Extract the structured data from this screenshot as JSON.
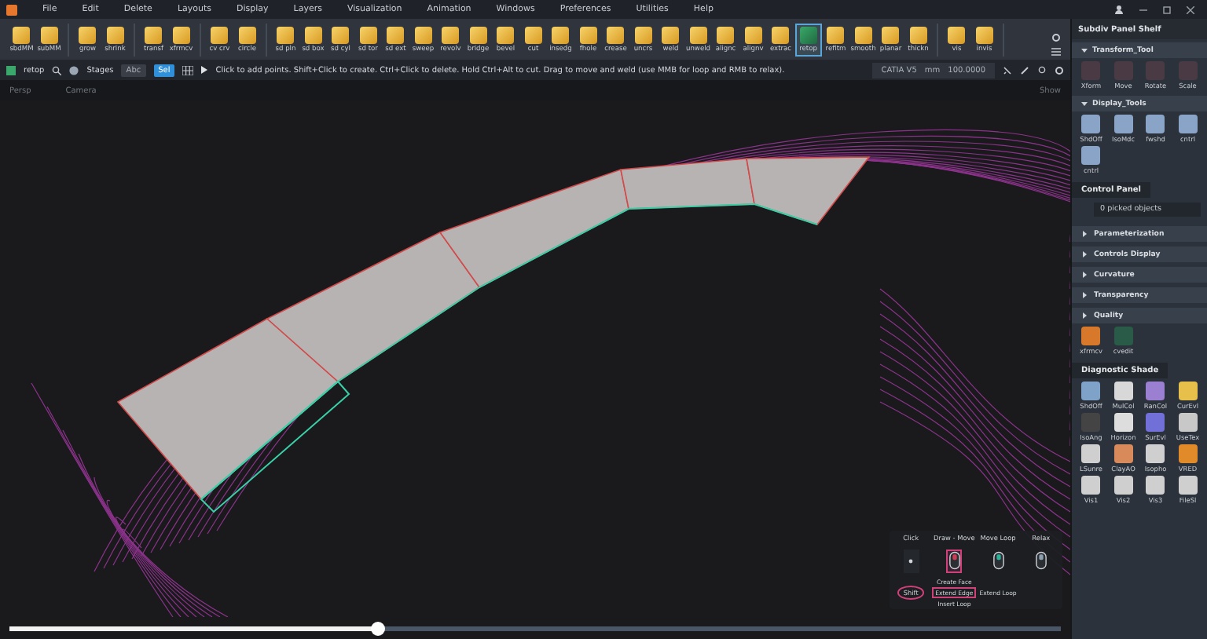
{
  "menu": [
    "File",
    "Edit",
    "Delete",
    "Layouts",
    "Display",
    "Layers",
    "Visualization",
    "Animation",
    "Windows",
    "Preferences",
    "Utilities",
    "Help"
  ],
  "toolbar": {
    "groups": [
      [
        {
          "label": "sbdMM",
          "selected": false
        },
        {
          "label": "subMM",
          "selected": false
        }
      ],
      [
        {
          "label": "grow",
          "selected": false
        },
        {
          "label": "shrink",
          "selected": false
        }
      ],
      [
        {
          "label": "transf",
          "selected": false
        },
        {
          "label": "xfrmcv",
          "selected": false
        }
      ],
      [
        {
          "label": "cv crv",
          "selected": false
        },
        {
          "label": "circle",
          "selected": false
        }
      ],
      [
        {
          "label": "sd pln",
          "selected": false
        },
        {
          "label": "sd box",
          "selected": false
        },
        {
          "label": "sd cyl",
          "selected": false
        },
        {
          "label": "sd tor",
          "selected": false
        },
        {
          "label": "sd ext",
          "selected": false
        },
        {
          "label": "sweep",
          "selected": false
        },
        {
          "label": "revolv",
          "selected": false
        },
        {
          "label": "bridge",
          "selected": false
        },
        {
          "label": "bevel",
          "selected": false
        },
        {
          "label": "cut",
          "selected": false
        },
        {
          "label": "insedg",
          "selected": false
        },
        {
          "label": "fhole",
          "selected": false
        },
        {
          "label": "crease",
          "selected": false
        },
        {
          "label": "uncrs",
          "selected": false
        },
        {
          "label": "weld",
          "selected": false
        },
        {
          "label": "unweld",
          "selected": false
        },
        {
          "label": "alignc",
          "selected": false
        },
        {
          "label": "alignv",
          "selected": false
        },
        {
          "label": "extrac",
          "selected": false
        },
        {
          "label": "retop",
          "selected": true
        },
        {
          "label": "refitm",
          "selected": false
        },
        {
          "label": "smooth",
          "selected": false
        },
        {
          "label": "planar",
          "selected": false
        },
        {
          "label": "thickn",
          "selected": false
        }
      ],
      [
        {
          "label": "vis",
          "selected": false
        },
        {
          "label": "invis",
          "selected": false
        }
      ]
    ]
  },
  "command_bar": {
    "tool": "retop",
    "stages": "Stages",
    "toggles": [
      {
        "label": "Abc",
        "selected": false
      },
      {
        "label": "Sel",
        "selected": true
      }
    ],
    "hint": "Click to add points. Shift+Click to create. Ctrl+Click to delete. Hold Ctrl+Alt to cut. Drag to move and weld (use MMB for loop and RMB to relax).",
    "standard": "CATIA V5",
    "unit": "mm",
    "tolerance": "100.0000"
  },
  "viewport": {
    "view": "Persp",
    "camera": "Camera",
    "show": "Show"
  },
  "mouse_hints": {
    "columns": [
      {
        "title": "Click",
        "highlighted": false
      },
      {
        "title": "Draw - Move",
        "highlighted": true
      },
      {
        "title": "Move Loop",
        "highlighted": false
      },
      {
        "title": "Relax",
        "highlighted": false
      }
    ],
    "modifier": {
      "label": "Shift",
      "highlighted": true
    },
    "actions": [
      {
        "label": "Create Face",
        "highlighted": false
      },
      {
        "label": "Extend Edge",
        "highlighted": true
      },
      {
        "label": "Insert Loop",
        "highlighted": false
      },
      {
        "label": "Extend Loop",
        "highlighted": false
      }
    ]
  },
  "timeline": {
    "level": 0.35
  },
  "right_panel": {
    "title": "Subdiv Panel Shelf",
    "shelves": [
      {
        "title": "Transform_Tool",
        "items": [
          "Xform",
          "Move",
          "Rotate",
          "Scale"
        ]
      },
      {
        "title": "Display_Tools",
        "items": [
          "ShdOff",
          "IsoMdc",
          "fwshd",
          "cntrl",
          "cntrl"
        ]
      }
    ],
    "control_panel": {
      "tab": "Control Panel",
      "picked": "0 picked objects",
      "sections": [
        {
          "label": "Parameterization",
          "expanded": false
        },
        {
          "label": "Controls Display",
          "expanded": false
        },
        {
          "label": "Curvature",
          "expanded": false
        },
        {
          "label": "Transparency",
          "expanded": false
        },
        {
          "label": "Quality",
          "expanded": false
        }
      ]
    },
    "shelf_items": [
      "xfrmcv",
      "cvedit"
    ],
    "diagnostic": {
      "tab": "Diagnostic Shade",
      "items": [
        "ShdOff",
        "MulCol",
        "RanCol",
        "CurEvl",
        "IsoAng",
        "Horizon",
        "SurEvl",
        "UseTex",
        "LSunre",
        "ClayAO",
        "Isopho",
        "VRED",
        "Vis1",
        "Vis2",
        "Vis3",
        "FileSl"
      ]
    }
  }
}
